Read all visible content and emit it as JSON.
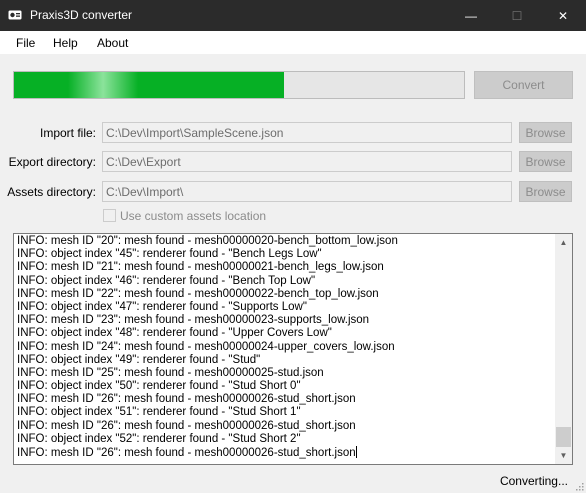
{
  "window": {
    "title": "Praxis3D converter",
    "icon": "projector-icon",
    "controls": {
      "minimize": "—",
      "maximize": "☐",
      "close": "✕"
    }
  },
  "menu": {
    "items": [
      "File",
      "Help",
      "About"
    ]
  },
  "progress": {
    "fraction": 0.6
  },
  "buttons": {
    "convert": "Convert",
    "browse": "Browse"
  },
  "fields": {
    "import": {
      "label": "Import file:",
      "value": "C:\\Dev\\Import\\SampleScene.json"
    },
    "export": {
      "label": "Export directory:",
      "value": "C:\\Dev\\Export"
    },
    "assets": {
      "label": "Assets directory:",
      "value": "C:\\Dev\\Import\\"
    }
  },
  "checkbox": {
    "label": "Use custom assets location",
    "checked": false
  },
  "log": {
    "lines": [
      "INFO: mesh ID \"20\": mesh found - mesh00000020-bench_bottom_low.json",
      "INFO: object index \"45\": renderer found - \"Bench Legs Low\"",
      "INFO: mesh ID \"21\": mesh found - mesh00000021-bench_legs_low.json",
      "INFO: object index \"46\": renderer found - \"Bench Top Low\"",
      "INFO: mesh ID \"22\": mesh found - mesh00000022-bench_top_low.json",
      "INFO: object index \"47\": renderer found - \"Supports Low\"",
      "INFO: mesh ID \"23\": mesh found - mesh00000023-supports_low.json",
      "INFO: object index \"48\": renderer found - \"Upper Covers Low\"",
      "INFO: mesh ID \"24\": mesh found - mesh00000024-upper_covers_low.json",
      "INFO: object index \"49\": renderer found - \"Stud\"",
      "INFO: mesh ID \"25\": mesh found - mesh00000025-stud.json",
      "INFO: object index \"50\": renderer found - \"Stud Short 0\"",
      "INFO: mesh ID \"26\": mesh found - mesh00000026-stud_short.json",
      "INFO: object index \"51\": renderer found - \"Stud Short 1\"",
      "INFO: mesh ID \"26\": mesh found - mesh00000026-stud_short.json",
      "INFO: object index \"52\": renderer found - \"Stud Short 2\"",
      "INFO: mesh ID \"26\": mesh found - mesh00000026-stud_short.json"
    ]
  },
  "status": {
    "text": "Converting..."
  }
}
